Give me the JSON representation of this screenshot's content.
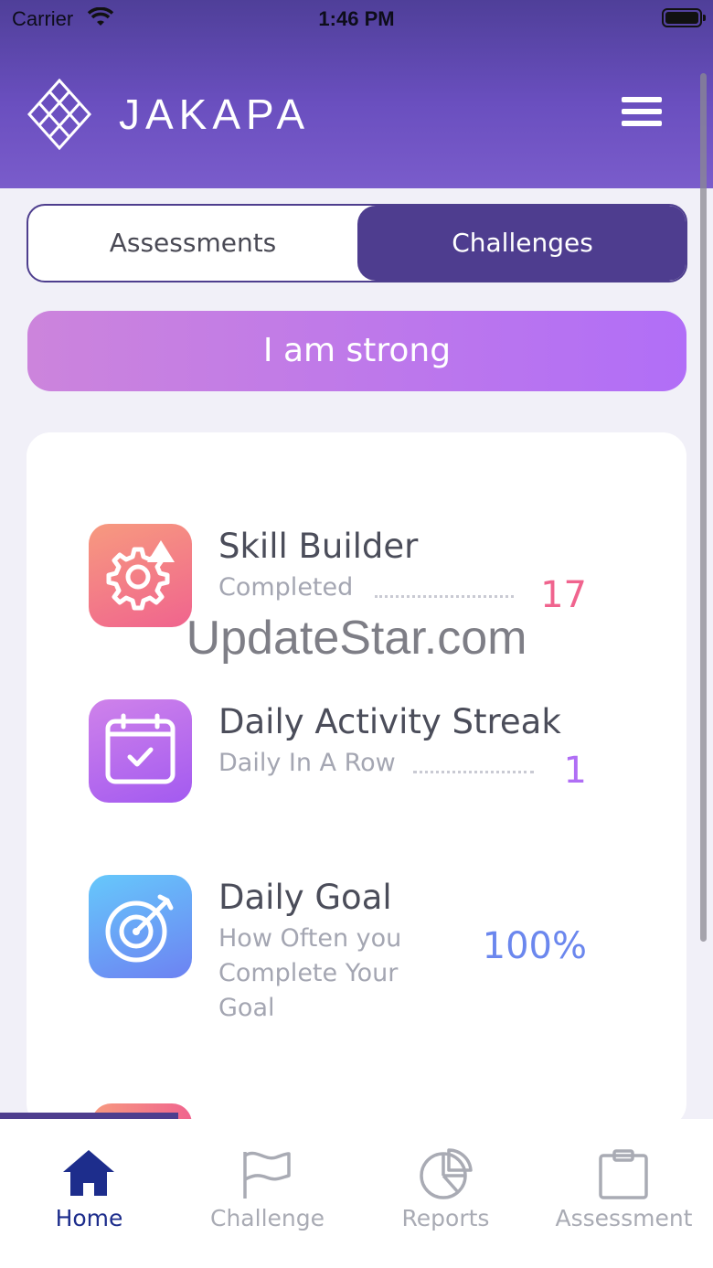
{
  "status_bar": {
    "carrier": "Carrier",
    "time": "1:46 PM"
  },
  "header": {
    "brand": "JAKAPA",
    "logo_icon": "lattice-logo-icon",
    "menu_icon": "hamburger-menu-icon"
  },
  "segmented": {
    "options": [
      "Assessments",
      "Challenges"
    ],
    "selected": "Challenges"
  },
  "banner": {
    "text": "I am strong"
  },
  "stats": [
    {
      "title": "Skill Builder",
      "subtitle": "Completed",
      "value": "17",
      "icon": "gear-triangle-icon",
      "color": "#f0648e"
    },
    {
      "title": "Daily Activity Streak",
      "subtitle": "Daily In A Row",
      "value": "1",
      "icon": "calendar-check-icon",
      "color": "#b06ef5"
    },
    {
      "title": "Daily Goal",
      "subtitle_lines": [
        "How Often you",
        "Complete Your",
        "Goal"
      ],
      "value": "100%",
      "icon": "target-arrow-icon",
      "color": "#6b87ee"
    }
  ],
  "watermark": "UpdateStar.com",
  "tabs": [
    {
      "label": "Home",
      "icon": "home-icon",
      "active": true
    },
    {
      "label": "Challenge",
      "icon": "flag-icon",
      "active": false
    },
    {
      "label": "Reports",
      "icon": "pie-chart-icon",
      "active": false
    },
    {
      "label": "Assessment",
      "icon": "clipboard-icon",
      "active": false
    }
  ],
  "colors": {
    "header": "#5b46ad",
    "accent": "#4e3e8e",
    "banner_start": "#cc84dc",
    "banner_end": "#b16ef7"
  }
}
